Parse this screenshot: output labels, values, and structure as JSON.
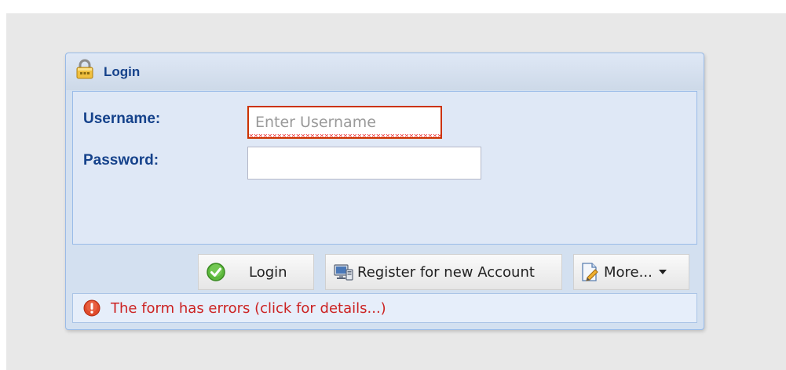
{
  "panel": {
    "title": "Login",
    "icon": "lock-icon"
  },
  "form": {
    "username": {
      "label": "Username:",
      "placeholder": "Enter Username",
      "value": ""
    },
    "password": {
      "label": "Password:",
      "placeholder": "",
      "value": ""
    }
  },
  "toolbar": {
    "login_label": "Login",
    "register_label": "Register for new Account",
    "more_label": "More..."
  },
  "status": {
    "message": "The form has errors (click for details...)",
    "icon": "error-icon"
  },
  "colors": {
    "title": "#15428b",
    "error": "#cc2222",
    "panel_border": "#99bbe8",
    "invalid_border": "#cc3300"
  }
}
